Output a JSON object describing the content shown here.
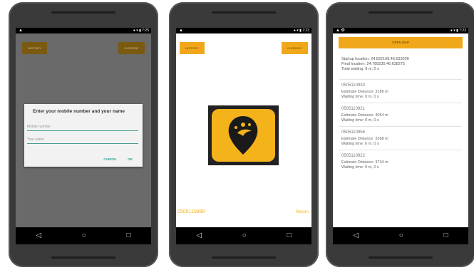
{
  "phone1": {
    "history_button": "HISTORY",
    "current_button": "CURRENT",
    "dialog": {
      "title": "Enter your mobile number and your name",
      "mobile_placeholder": "Mobile number",
      "name_placeholder": "Your name",
      "cancel": "CANCEL",
      "ok": "OK"
    }
  },
  "phone2": {
    "history_button": "HISTORY",
    "current_button": "CURRENT",
    "phone_number": "0505110888",
    "return_label": "Return"
  },
  "phone3": {
    "open_map_button": "OPEN MAP",
    "startup_location": "Startup location: 24.822108,46.633200",
    "final_location": "Final location: 24.788230,46.638275",
    "total_waiting": "Total waiting: 8 m, 0 s",
    "entries": [
      {
        "number": "0505110933",
        "distance": "Estimate Distance: 3189 m",
        "waiting": "Waiting time: 0 m, 0 s"
      },
      {
        "number": "0505110921",
        "distance": "Estimate Distance: 4054 m",
        "waiting": "Waiting time: 0 m, 0 s"
      },
      {
        "number": "0505110956",
        "distance": "Estimate Distance: 3268 m",
        "waiting": "Waiting time: 0 m, 0 s"
      },
      {
        "number": "0505110922",
        "distance": "Estimate Distance: 3734 m",
        "waiting": "Waiting time: 0 m, 0 s"
      }
    ]
  },
  "status": {
    "time1": "7:25",
    "time2": "7:23",
    "time3": "7:23"
  },
  "colors": {
    "accent": "#f0a81a",
    "dialog_accent": "#2a9d8f",
    "dim_button": "#7a5a10"
  },
  "icons": {
    "nav_back": "back-triangle-icon",
    "nav_home": "home-circle-icon",
    "nav_recent": "recent-square-icon"
  }
}
